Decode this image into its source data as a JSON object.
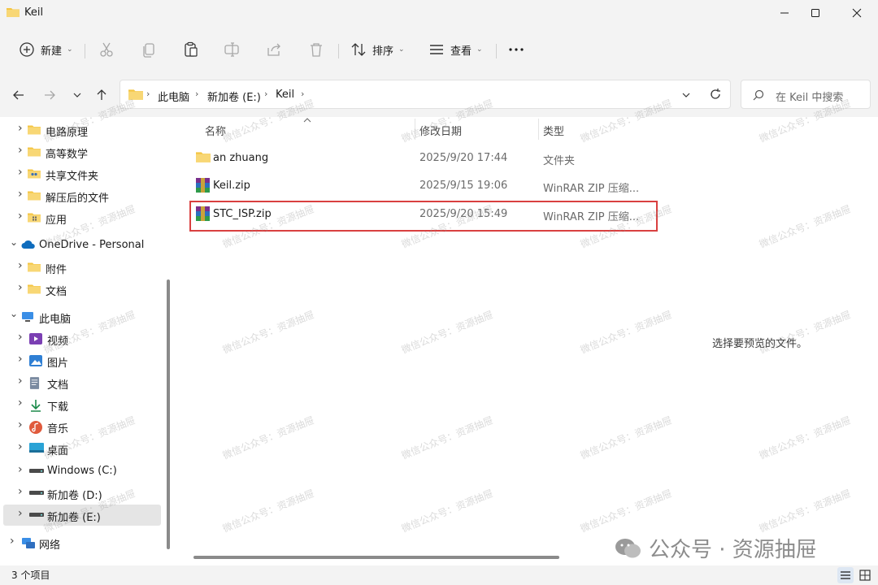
{
  "window": {
    "title": "Keil",
    "controls": [
      "minimize-icon",
      "maximize-icon",
      "close-icon"
    ]
  },
  "toolbar": {
    "new_label": "新建",
    "sort_label": "排序",
    "view_label": "查看",
    "more_icon": "more-icon",
    "icons": [
      "plus-circle-icon",
      "cut-icon",
      "copy-icon",
      "paste-icon",
      "rename-icon",
      "share-icon",
      "delete-icon",
      "sort-icon",
      "view-icon"
    ]
  },
  "address": {
    "crumbs": [
      "此电脑",
      "新加卷 (E:)",
      "Keil"
    ],
    "search_placeholder": "在 Keil 中搜索"
  },
  "nav": {
    "items": [
      {
        "label": "电路原理",
        "icon": "folder-icon"
      },
      {
        "label": "高等数学",
        "icon": "folder-icon"
      },
      {
        "label": "共享文件夹",
        "icon": "shared-folder-icon"
      },
      {
        "label": "解压后的文件",
        "icon": "folder-icon"
      },
      {
        "label": "应用",
        "icon": "apps-folder-icon"
      },
      {
        "label": "OneDrive - Personal",
        "icon": "cloud-icon"
      },
      {
        "label": "附件",
        "icon": "folder-icon"
      },
      {
        "label": "文档",
        "icon": "folder-icon"
      },
      {
        "label": "此电脑",
        "icon": "computer-icon"
      },
      {
        "label": "视频",
        "icon": "video-icon"
      },
      {
        "label": "图片",
        "icon": "pictures-icon"
      },
      {
        "label": "文档",
        "icon": "documents-icon"
      },
      {
        "label": "下载",
        "icon": "download-icon"
      },
      {
        "label": "音乐",
        "icon": "music-icon"
      },
      {
        "label": "桌面",
        "icon": "desktop-icon"
      },
      {
        "label": "Windows (C:)",
        "icon": "drive-icon"
      },
      {
        "label": "新加卷 (D:)",
        "icon": "drive-icon"
      },
      {
        "label": "新加卷 (E:)",
        "icon": "drive-icon",
        "selected": true
      },
      {
        "label": "网络",
        "icon": "network-icon"
      }
    ]
  },
  "files": {
    "columns": [
      "名称",
      "修改日期",
      "类型"
    ],
    "rows": [
      {
        "name": "an zhuang",
        "modified": "2025/9/20 17:44",
        "type": "文件夹",
        "icon": "folder-icon"
      },
      {
        "name": "Keil.zip",
        "modified": "2025/9/15 19:06",
        "type": "WinRAR ZIP 压缩...",
        "icon": "winrar-archive-icon"
      },
      {
        "name": "STC_ISP.zip",
        "modified": "2025/9/20 15:49",
        "type": "WinRAR ZIP 压缩...",
        "icon": "winrar-archive-icon",
        "highlighted": true
      }
    ]
  },
  "preview": {
    "message": "选择要预览的文件。"
  },
  "status": {
    "count": "3 个项目"
  },
  "watermark": {
    "text": "微信公众号：资源抽屉",
    "brand": "公众号 · 资源抽屉"
  },
  "colors": {
    "chrome_bg": "#f3f3f3",
    "folder": "#f4c542",
    "accent": "#0067c0",
    "highlight_border": "#d94040"
  }
}
